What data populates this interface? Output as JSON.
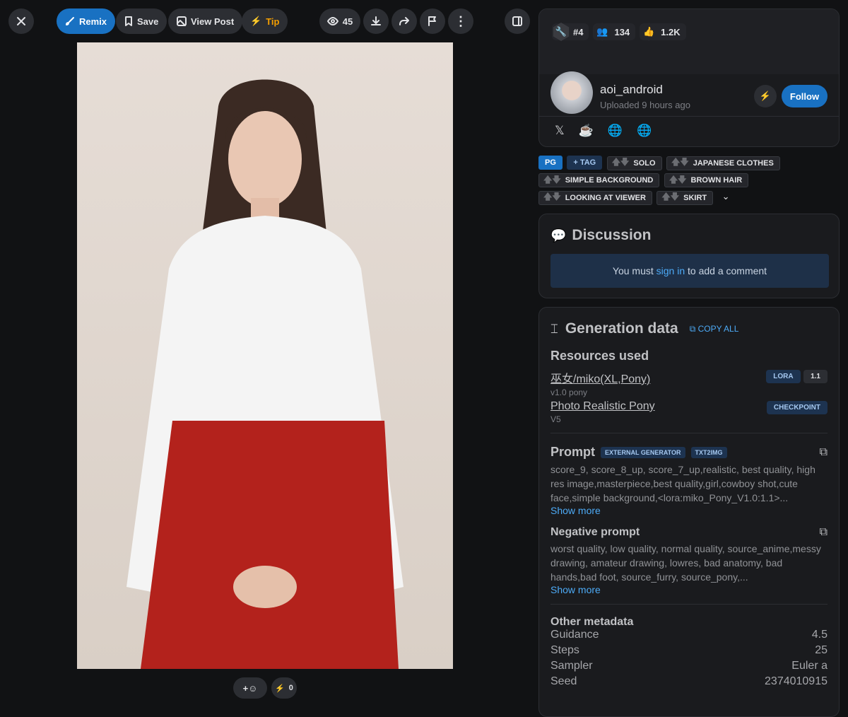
{
  "toolbar": {
    "remix": "Remix",
    "save": "Save",
    "view_post": "View Post",
    "tip": "Tip",
    "views": "45"
  },
  "image": {
    "reactions": "0"
  },
  "stats": {
    "rank": "#4",
    "followers": "134",
    "likes": "1.2K"
  },
  "user": {
    "name": "aoi_android",
    "uploaded": "Uploaded 9 hours ago",
    "follow": "Follow"
  },
  "tags": {
    "rating": "PG",
    "add": "+ TAG",
    "items": [
      "SOLO",
      "JAPANESE CLOTHES",
      "SIMPLE BACKGROUND",
      "BROWN HAIR",
      "LOOKING AT VIEWER",
      "SKIRT"
    ]
  },
  "discussion": {
    "title": "Discussion",
    "pre": "You must ",
    "link": "sign in",
    "post": " to add a comment"
  },
  "generation": {
    "title": "Generation data",
    "copy_all": "COPY ALL",
    "resources_title": "Resources used",
    "resources": [
      {
        "name": "巫女/miko(XL,Pony)",
        "version": "v1.0 pony",
        "type": "LORA",
        "weight": "1.1"
      },
      {
        "name": "Photo Realistic Pony",
        "version": "V5",
        "type": "CHECKPOINT"
      }
    ],
    "prompt_title": "Prompt",
    "badge1": "EXTERNAL GENERATOR",
    "badge2": "TXT2IMG",
    "prompt": "score_9, score_8_up, score_7_up,realistic, best quality, high res image,masterpiece,best quality,girl,cowboy shot,cute face,simple background,<lora:miko_Pony_V1.0:1.1>...",
    "show_more": "Show more",
    "neg_title": "Negative prompt",
    "negative": "worst quality, low quality, normal quality, source_anime,messy drawing, amateur drawing, lowres, bad anatomy, bad hands,bad foot, source_furry, source_pony,...",
    "other_title": "Other metadata",
    "meta": [
      {
        "k": "Guidance",
        "v": "4.5"
      },
      {
        "k": "Steps",
        "v": "25"
      },
      {
        "k": "Sampler",
        "v": "Euler a"
      },
      {
        "k": "Seed",
        "v": "2374010915"
      }
    ]
  },
  "colors": {
    "accent": "#1971c2",
    "tip": "#f59f00",
    "link": "#4dabf7"
  }
}
